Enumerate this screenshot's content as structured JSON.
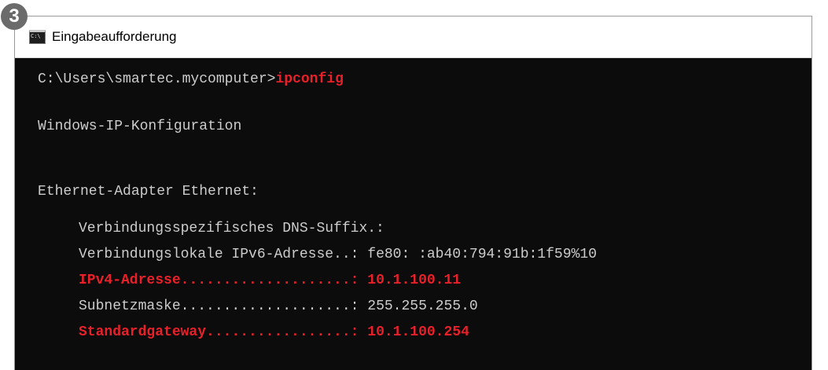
{
  "badge": {
    "number": "3"
  },
  "window": {
    "title": "Eingabeaufforderung"
  },
  "console": {
    "prompt": "C:\\Users\\smartec.mycomputer>",
    "command": "ipconfig",
    "header": "Windows-IP-Konfiguration",
    "adapter": "Ethernet-Adapter Ethernet:",
    "rows": [
      {
        "label": "Verbindungsspezifisches DNS-Suffix.:",
        "value": ""
      },
      {
        "label": "Verbindungslokale IPv6-Adresse..:",
        "value": " fe80: :ab40:794:91b:1f59%10"
      },
      {
        "label": "IPv4-Adresse....................:",
        "value": " 10.1.100.11"
      },
      {
        "label": "Subnetzmaske....................:",
        "value": " 255.255.255.0"
      },
      {
        "label": "Standardgateway.................:",
        "value": " 10.1.100.254"
      }
    ],
    "highlight_color": "#e8202a"
  }
}
